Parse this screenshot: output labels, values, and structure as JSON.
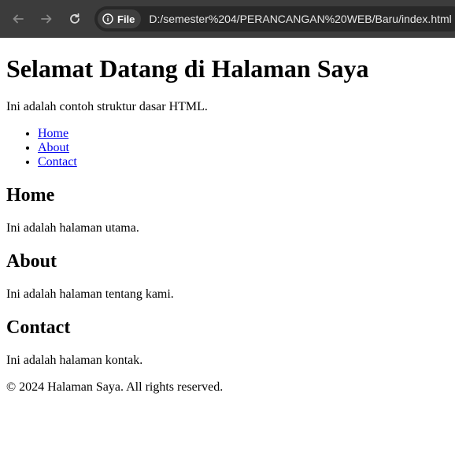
{
  "browser": {
    "site_label": "File",
    "url": "D:/semester%204/PERANCANGAN%20WEB/Baru/index.html"
  },
  "header": {
    "title": "Selamat Datang di Halaman Saya",
    "intro": "Ini adalah contoh struktur dasar HTML."
  },
  "nav": {
    "items": [
      {
        "label": "Home"
      },
      {
        "label": "About"
      },
      {
        "label": "Contact"
      }
    ]
  },
  "sections": [
    {
      "heading": "Home",
      "text": "Ini adalah halaman utama."
    },
    {
      "heading": "About",
      "text": "Ini adalah halaman tentang kami."
    },
    {
      "heading": "Contact",
      "text": "Ini adalah halaman kontak."
    }
  ],
  "footer": {
    "text": "© 2024 Halaman Saya. All rights reserved."
  }
}
